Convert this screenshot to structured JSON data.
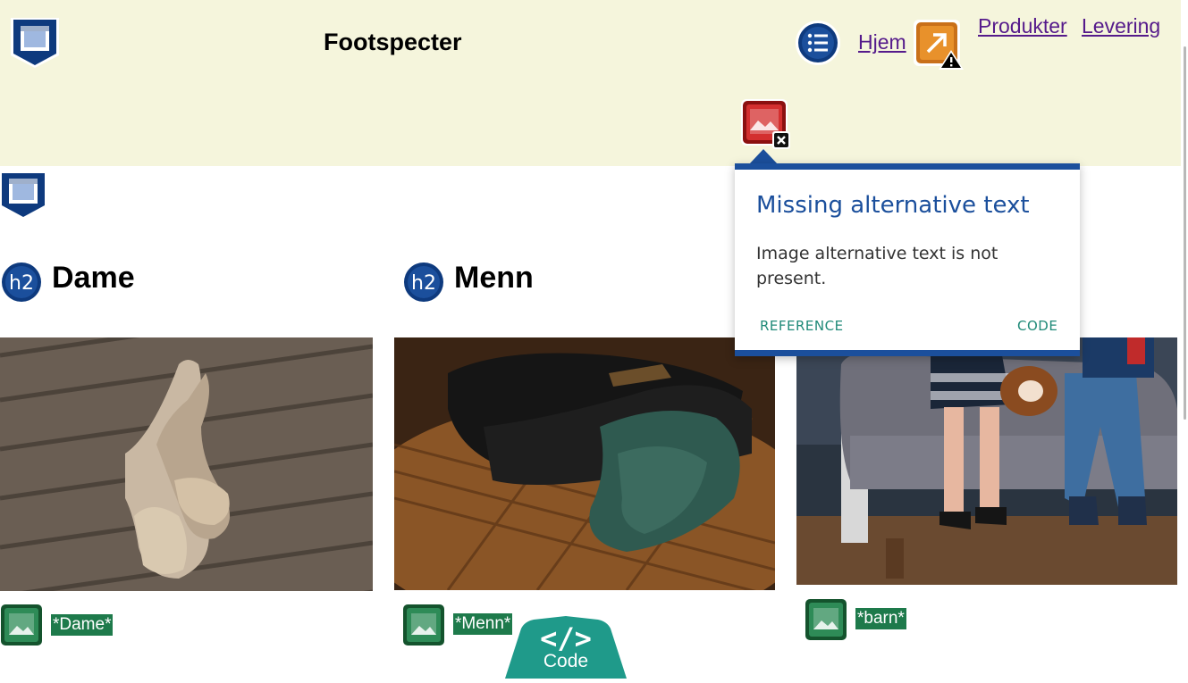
{
  "header": {
    "site_title": "Footspecter",
    "nav": {
      "home": "Hjem",
      "products": "Produkter",
      "delivery": "Levering"
    }
  },
  "sections": [
    {
      "heading": "Dame",
      "alt_text": "*Dame*",
      "icon": "h2-badge-icon"
    },
    {
      "heading": "Menn",
      "alt_text": "*Menn*",
      "icon": "h2-badge-icon"
    },
    {
      "alt_text": "*barn*"
    }
  ],
  "tooltip": {
    "title": "Missing alternative text",
    "body": "Image alternative text is not present.",
    "reference_label": "REFERENCE",
    "code_label": "CODE"
  },
  "code_button": {
    "label": "Code",
    "glyph": "</>"
  },
  "badges": {
    "heading_badge_text": "h2",
    "heading_badge_text_2": "h2"
  },
  "colors": {
    "header_bg": "#f5f5dc",
    "accent_blue": "#1b4f9c",
    "link_purple": "#551a8b",
    "alt_green": "#1e7a4b",
    "error_red": "#c62828",
    "teal": "#1f9a8a"
  }
}
